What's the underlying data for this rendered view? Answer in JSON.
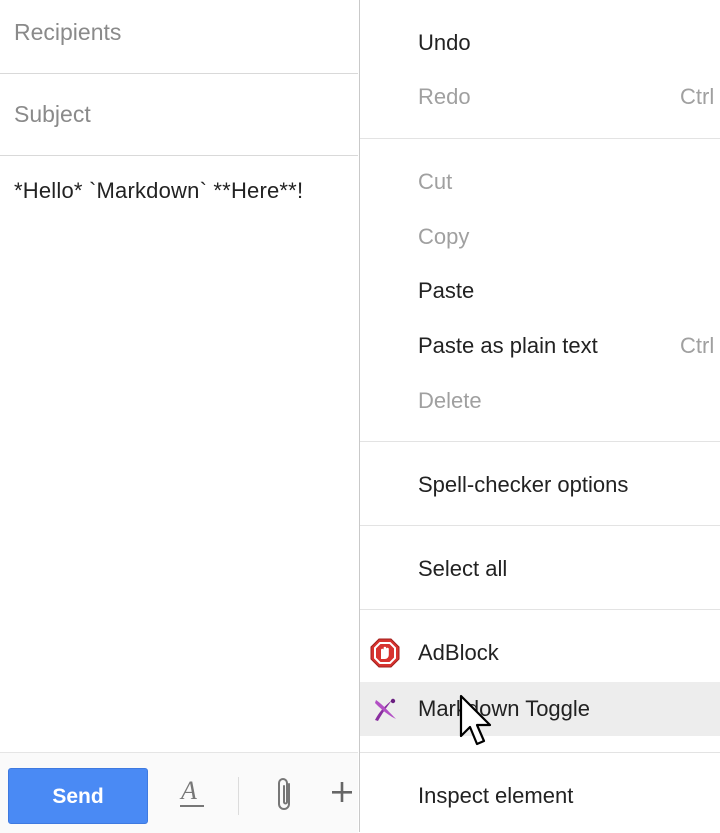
{
  "compose": {
    "recipients_placeholder": "Recipients",
    "subject_placeholder": "Subject",
    "body": "*Hello* `Markdown` **Here**!",
    "send_label": "Send",
    "format_icon": "text-format-icon",
    "attach_icon": "paperclip-icon",
    "more_icon": "plus-icon",
    "send_color": "#4a8af4"
  },
  "context_menu": {
    "undo": "Undo",
    "redo": "Redo",
    "redo_shortcut": "Ctrl",
    "cut": "Cut",
    "copy": "Copy",
    "paste": "Paste",
    "paste_plain": "Paste as plain text",
    "paste_plain_shortcut": "Ctrl",
    "delete": "Delete",
    "spell": "Spell-checker options",
    "select_all": "Select all",
    "adblock": "AdBlock",
    "markdown_toggle": "Markdown Toggle",
    "inspect": "Inspect element",
    "hover_color": "#ededed"
  }
}
